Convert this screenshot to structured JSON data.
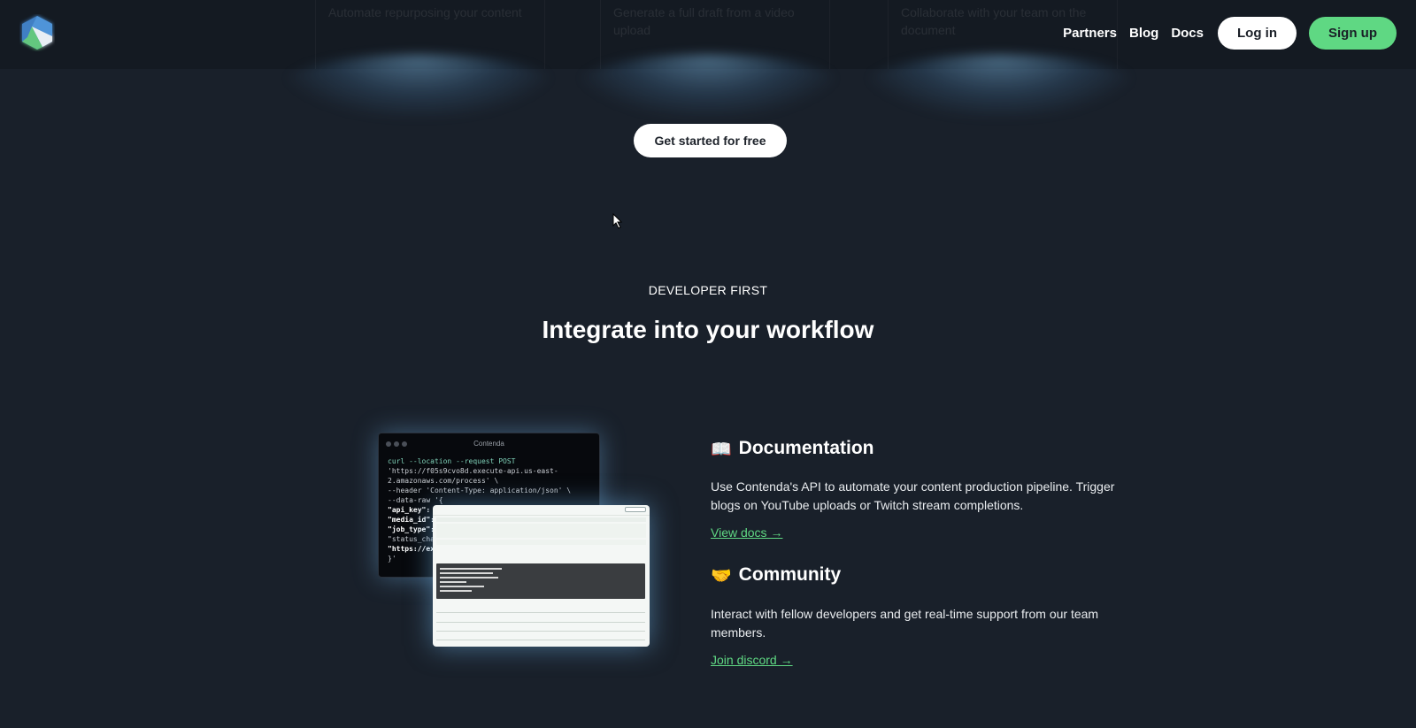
{
  "top_cards": [
    {
      "text": "Automate repurposing your content"
    },
    {
      "text": "Generate a full draft from a video upload"
    },
    {
      "text": "Collaborate with your team on the document"
    }
  ],
  "header": {
    "logo": "contenda-logo",
    "nav": [
      {
        "label": "Partners"
      },
      {
        "label": "Blog"
      },
      {
        "label": "Docs"
      }
    ],
    "login_label": "Log in",
    "signup_label": "Sign up"
  },
  "cta_label": "Get started for free",
  "section": {
    "eyebrow": "DEVELOPER FIRST",
    "title": "Integrate into your workflow"
  },
  "terminal": {
    "title": "Contenda",
    "lines": [
      "curl --location --request POST",
      "'https://f05s9cvo8d.execute-api.us-east-",
      "2.amazonaws.com/process' \\",
      "--header 'Content-Type: application/json' \\",
      "--data-raw '{",
      "\"api_key\":",
      "\"media_id\":",
      "\"job_type\":",
      "\"status_char",
      "\"https://exa",
      "}'"
    ]
  },
  "features": [
    {
      "emoji": "📖",
      "icon": "open-book-icon",
      "title": "Documentation",
      "description": "Use Contenda's API to automate your content production pipeline. Trigger blogs on YouTube uploads or Twitch stream completions.",
      "link": "View docs →"
    },
    {
      "emoji": "🤝",
      "icon": "handshake-icon",
      "title": "Community",
      "description": "Interact with fellow developers and get real-time support from our team members.",
      "link": "Join discord →"
    }
  ],
  "colors": {
    "background": "#19202a",
    "accent_green": "#5fd883",
    "glow": "#78afd7"
  }
}
